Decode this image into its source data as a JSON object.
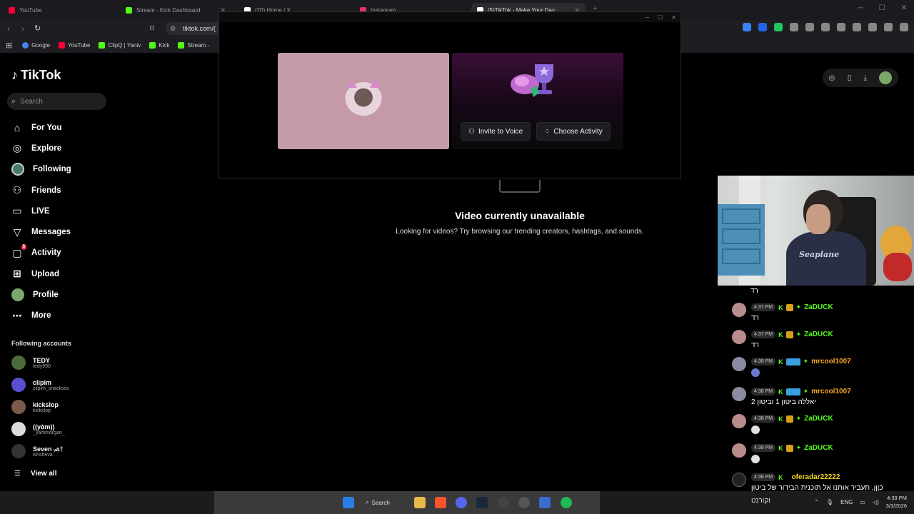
{
  "browser": {
    "tabs": [
      {
        "label": "YouTube",
        "color": "#ff0033"
      },
      {
        "label": "Stream - Kick Dashboard",
        "color": "#53fc18"
      },
      {
        "label": "(20) Home / X",
        "color": "#ffffff"
      },
      {
        "label": "Instagram",
        "color": "#e1306c"
      },
      {
        "label": "(5)TikTok - Make Your Day",
        "color": "#ffffff"
      }
    ],
    "new_tab": "+",
    "url": "tiktok.com/(",
    "bookmarks": [
      {
        "label": "Google",
        "color": "#4285f4"
      },
      {
        "label": "YouTube",
        "color": "#ff0033"
      },
      {
        "label": "ClipQ | Yaniv",
        "color": "#53fc18"
      },
      {
        "label": "Kick",
        "color": "#53fc18"
      },
      {
        "label": "Stream -",
        "color": "#53fc18"
      }
    ]
  },
  "tiktok": {
    "logo": "TikTok",
    "search_placeholder": "Search",
    "menu": [
      {
        "label": "For You",
        "icon": "home-icon"
      },
      {
        "label": "Explore",
        "icon": "compass-icon"
      },
      {
        "label": "Following",
        "icon": "following-avatar-icon"
      },
      {
        "label": "Friends",
        "icon": "friends-icon"
      },
      {
        "label": "LIVE",
        "icon": "live-icon"
      },
      {
        "label": "Messages",
        "icon": "messages-icon"
      },
      {
        "label": "Activity",
        "icon": "activity-icon",
        "badge": "5"
      },
      {
        "label": "Upload",
        "icon": "upload-icon"
      },
      {
        "label": "Profile",
        "icon": "profile-avatar-icon"
      },
      {
        "label": "More",
        "icon": "more-icon"
      }
    ],
    "following_title": "Following accounts",
    "accounts": [
      {
        "name": "TEDY",
        "handle": "tedy990",
        "color": "#4b6b3a"
      },
      {
        "name": "clipim",
        "handle": "clipim_snacksss",
        "color": "#5b4fd1"
      },
      {
        "name": "kickslop",
        "handle": "kickslop",
        "color": "#7a5a4a"
      },
      {
        "name": "((yὰm))",
        "handle": "_yammorgan_",
        "color": "#dddddd"
      },
      {
        "name": "Seven ᵥᴀ†",
        "handle": "ishsheva",
        "color": "#333333"
      }
    ],
    "view_all": "View all",
    "unavailable_title": "Video currently unavailable",
    "unavailable_sub": "Looking for videos? Try browsing our trending creators, hashtags, and sounds."
  },
  "discord": {
    "invite_label": "Invite to Voice",
    "activity_label": "Choose Activity",
    "user_tile_color": "#c49aa9"
  },
  "chat": {
    "top_text": "רד",
    "messages": [
      {
        "time": "4:37 PM",
        "user": "ZaDUCK",
        "user_color": "#53fc18",
        "text": "רד"
      },
      {
        "time": "4:37 PM",
        "user": "ZaDUCK",
        "user_color": "#53fc18",
        "text": "רד"
      },
      {
        "time": "4:38 PM",
        "user": "mrcool1007",
        "user_color": "#f5a623",
        "text": ""
      },
      {
        "time": "4:38 PM",
        "user": "mrcool1007",
        "user_color": "#f5a623",
        "text": "יאללה ביטון 1 וביטון 2"
      },
      {
        "time": "4:38 PM",
        "user": "ZaDUCK",
        "user_color": "#53fc18",
        "text": ""
      },
      {
        "time": "4:38 PM",
        "user": "ZaDUCK",
        "user_color": "#53fc18",
        "text": ""
      },
      {
        "time": "4:38 PM",
        "user": "oferadar22222",
        "user_color": "#f5d523",
        "text": "כןןן, תעביר אותנו אל תוכנית הבידור של ביטון"
      }
    ]
  },
  "webcam": {
    "hoodie_text": "Seaplane"
  },
  "taskbar": {
    "search_label": "Search",
    "lang": "ENG",
    "time": "4:39 PM",
    "date": "3/3/2026",
    "hebrew_text": "וקורנט"
  }
}
